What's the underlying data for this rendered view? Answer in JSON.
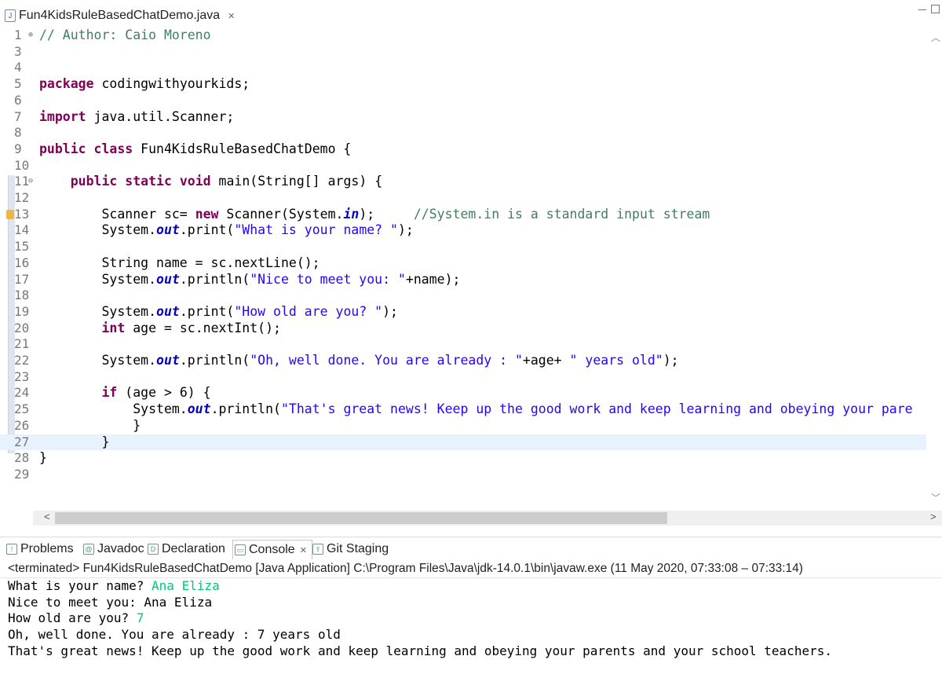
{
  "editor": {
    "tab_title": "Fun4KidsRuleBasedChatDemo.java",
    "tab_close": "✕",
    "lines": [
      {
        "n": "1",
        "parts": [
          [
            "cm",
            "// Author: Caio Moreno"
          ]
        ],
        "fold": "⊕"
      },
      {
        "n": "3",
        "parts": []
      },
      {
        "n": "4",
        "parts": []
      },
      {
        "n": "5",
        "parts": [
          [
            "kw",
            "package"
          ],
          [
            "pl",
            " codingwithyourkids;"
          ]
        ]
      },
      {
        "n": "6",
        "parts": []
      },
      {
        "n": "7",
        "parts": [
          [
            "kw",
            "import"
          ],
          [
            "pl",
            " java.util.Scanner;"
          ]
        ]
      },
      {
        "n": "8",
        "parts": []
      },
      {
        "n": "9",
        "parts": [
          [
            "kw",
            "public"
          ],
          [
            "pl",
            " "
          ],
          [
            "kw",
            "class"
          ],
          [
            "pl",
            " Fun4KidsRuleBasedChatDemo {"
          ]
        ]
      },
      {
        "n": "10",
        "parts": []
      },
      {
        "n": "11",
        "parts": [
          [
            "pl",
            "    "
          ],
          [
            "kw",
            "public"
          ],
          [
            "pl",
            " "
          ],
          [
            "kw",
            "static"
          ],
          [
            "pl",
            " "
          ],
          [
            "kw",
            "void"
          ],
          [
            "pl",
            " main(String[] args) {"
          ]
        ],
        "fold": "⊖"
      },
      {
        "n": "12",
        "parts": []
      },
      {
        "n": "13",
        "parts": [
          [
            "pl",
            "        Scanner sc= "
          ],
          [
            "kw",
            "new"
          ],
          [
            "pl",
            " Scanner(System."
          ],
          [
            "fld",
            "in"
          ],
          [
            "pl",
            ");     "
          ],
          [
            "cm",
            "//System.in is a standard input stream"
          ]
        ],
        "warn": true
      },
      {
        "n": "14",
        "parts": [
          [
            "pl",
            "        System."
          ],
          [
            "fld",
            "out"
          ],
          [
            "pl",
            ".print("
          ],
          [
            "str",
            "\"What is your name? \""
          ],
          [
            "pl",
            ");"
          ]
        ]
      },
      {
        "n": "15",
        "parts": []
      },
      {
        "n": "16",
        "parts": [
          [
            "pl",
            "        String name = sc.nextLine();"
          ]
        ]
      },
      {
        "n": "17",
        "parts": [
          [
            "pl",
            "        System."
          ],
          [
            "fld",
            "out"
          ],
          [
            "pl",
            ".println("
          ],
          [
            "str",
            "\"Nice to meet you: \""
          ],
          [
            "pl",
            "+name);"
          ]
        ]
      },
      {
        "n": "18",
        "parts": []
      },
      {
        "n": "19",
        "parts": [
          [
            "pl",
            "        System."
          ],
          [
            "fld",
            "out"
          ],
          [
            "pl",
            ".print("
          ],
          [
            "str",
            "\"How old are you? \""
          ],
          [
            "pl",
            ");"
          ]
        ]
      },
      {
        "n": "20",
        "parts": [
          [
            "pl",
            "        "
          ],
          [
            "kw",
            "int"
          ],
          [
            "pl",
            " age = sc.nextInt();"
          ]
        ]
      },
      {
        "n": "21",
        "parts": []
      },
      {
        "n": "22",
        "parts": [
          [
            "pl",
            "        System."
          ],
          [
            "fld",
            "out"
          ],
          [
            "pl",
            ".println("
          ],
          [
            "str",
            "\"Oh, well done. You are already : \""
          ],
          [
            "pl",
            "+age+ "
          ],
          [
            "str",
            "\" years old\""
          ],
          [
            "pl",
            ");"
          ]
        ]
      },
      {
        "n": "23",
        "parts": []
      },
      {
        "n": "24",
        "parts": [
          [
            "pl",
            "        "
          ],
          [
            "kw",
            "if"
          ],
          [
            "pl",
            " (age > 6) {"
          ]
        ]
      },
      {
        "n": "25",
        "parts": [
          [
            "pl",
            "            System."
          ],
          [
            "fld",
            "out"
          ],
          [
            "pl",
            ".println("
          ],
          [
            "str",
            "\"That's great news! Keep up the good work and keep learning and obeying your pare"
          ]
        ]
      },
      {
        "n": "26",
        "parts": [
          [
            "pl",
            "            }"
          ]
        ]
      },
      {
        "n": "27",
        "parts": [
          [
            "pl",
            "        }"
          ]
        ],
        "current": true
      },
      {
        "n": "28",
        "parts": [
          [
            "pl",
            "}"
          ]
        ]
      },
      {
        "n": "29",
        "parts": []
      }
    ]
  },
  "views": {
    "tabs": [
      {
        "label": "Problems",
        "icon": "problems-icon",
        "glyph": "!"
      },
      {
        "label": "Javadoc",
        "icon": "javadoc-icon",
        "glyph": "@"
      },
      {
        "label": "Declaration",
        "icon": "declaration-icon",
        "glyph": "D"
      },
      {
        "label": "Console",
        "icon": "console-icon",
        "glyph": "▭",
        "active": true,
        "close": "✕"
      },
      {
        "label": "Git Staging",
        "icon": "git-staging-icon",
        "glyph": "⇪"
      }
    ]
  },
  "console": {
    "header": "<terminated> Fun4KidsRuleBasedChatDemo [Java Application] C:\\Program Files\\Java\\jdk-14.0.1\\bin\\javaw.exe  (11 May 2020, 07:33:08 – 07:33:14)",
    "lines": [
      {
        "out": "What is your name? ",
        "in": "Ana Eliza"
      },
      {
        "out": "Nice to meet you: Ana Eliza",
        "in": ""
      },
      {
        "out": "How old are you? ",
        "in": "7"
      },
      {
        "out": "Oh, well done. You are already : 7 years old",
        "in": ""
      },
      {
        "out": "That's great news! Keep up the good work and keep learning and obeying your parents and your school teachers.",
        "in": ""
      }
    ]
  }
}
